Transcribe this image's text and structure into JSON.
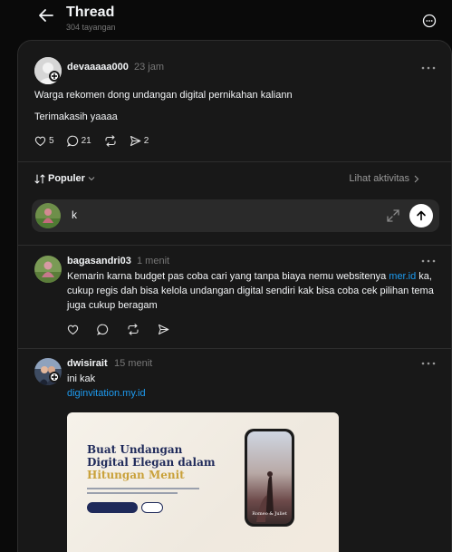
{
  "header": {
    "title": "Thread",
    "subtitle": "304 tayangan"
  },
  "main_post": {
    "username": "devaaaaa000",
    "time": "23 jam",
    "lines": [
      "Warga rekomen dong undangan digital pernikahan kaliann",
      "Terimakasih yaaaa"
    ],
    "likes": "5",
    "comments": "21",
    "shares": "2"
  },
  "sort": {
    "label": "Populer",
    "activity_label": "Lihat aktivitas"
  },
  "reply": {
    "value": "k"
  },
  "replies": [
    {
      "username": "bagasandri03",
      "time": "1 menit",
      "text_before": "Kemarin karna budget pas coba cari yang tanpa biaya nemu websitenya ",
      "link": "mer.id",
      "text_after": " ka, cukup regis dah bisa kelola undangan digital sendiri kak bisa coba cek pilihan tema juga cukup beragam"
    },
    {
      "username": "dwisirait",
      "time": "15 menit",
      "text": "ini kak",
      "link": "diginvitation.my.id",
      "preview": {
        "line1": "Buat Undangan",
        "line2": "Digital Elegan dalam",
        "line3": "Hitungan Menit",
        "phone_caption": "Romeo & Juliet"
      }
    }
  ],
  "colors": {
    "background": "#0a0a0a",
    "panel": "#181818",
    "link": "#1d9bf0",
    "muted": "#777777"
  }
}
